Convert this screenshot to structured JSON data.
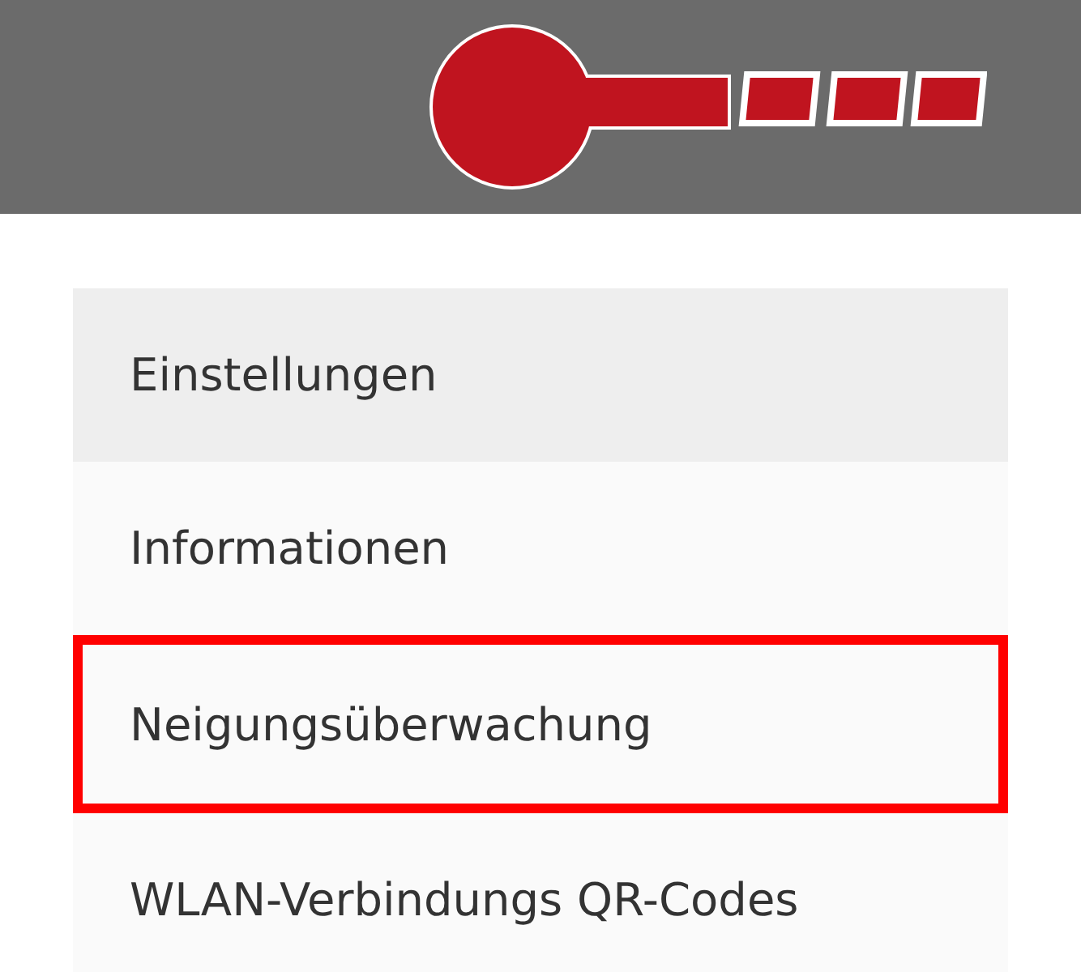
{
  "menu": {
    "items": [
      {
        "label": "Einstellungen",
        "selected": true,
        "highlighted": false
      },
      {
        "label": "Informationen",
        "selected": false,
        "highlighted": false
      },
      {
        "label": "Neigungsüberwachung",
        "selected": false,
        "highlighted": true
      },
      {
        "label": "WLAN-Verbindungs QR-Codes",
        "selected": false,
        "highlighted": false
      }
    ]
  }
}
